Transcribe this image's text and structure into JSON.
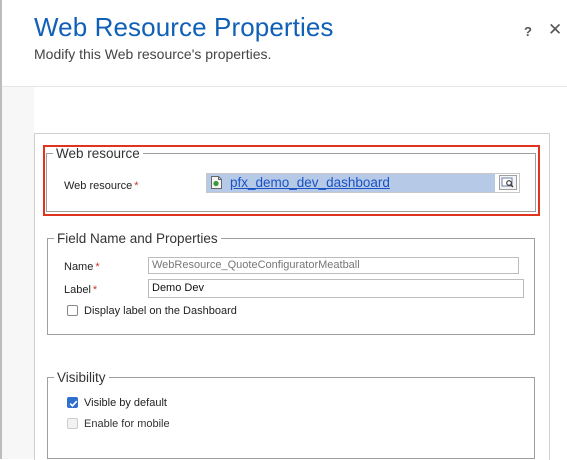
{
  "header": {
    "title": "Web Resource Properties",
    "subtitle": "Modify this Web resource's properties.",
    "help_label": "?",
    "close_label": "✕"
  },
  "web_resource_section": {
    "legend": "Web resource",
    "field_label": "Web resource",
    "required_mark": "*",
    "value": "pfx_demo_dev_dashboard"
  },
  "field_props_section": {
    "legend": "Field Name and Properties",
    "name_label": "Name",
    "name_value": "WebResource_QuoteConfiguratorMeatball",
    "label_label": "Label",
    "label_value": "Demo Dev",
    "required_mark": "*",
    "display_label_checkbox": "Display label on the Dashboard",
    "display_label_checked": false
  },
  "visibility_section": {
    "legend": "Visibility",
    "visible_default_label": "Visible by default",
    "visible_default_checked": true,
    "enable_mobile_label": "Enable for mobile",
    "enable_mobile_checked": false
  },
  "colors": {
    "title": "#1160b7",
    "highlight_border": "#e0341e",
    "lookup_selection": "#b6cae8",
    "link": "#1a52c4",
    "checkbox_checked": "#2f6fce",
    "required": "#c0392b"
  }
}
